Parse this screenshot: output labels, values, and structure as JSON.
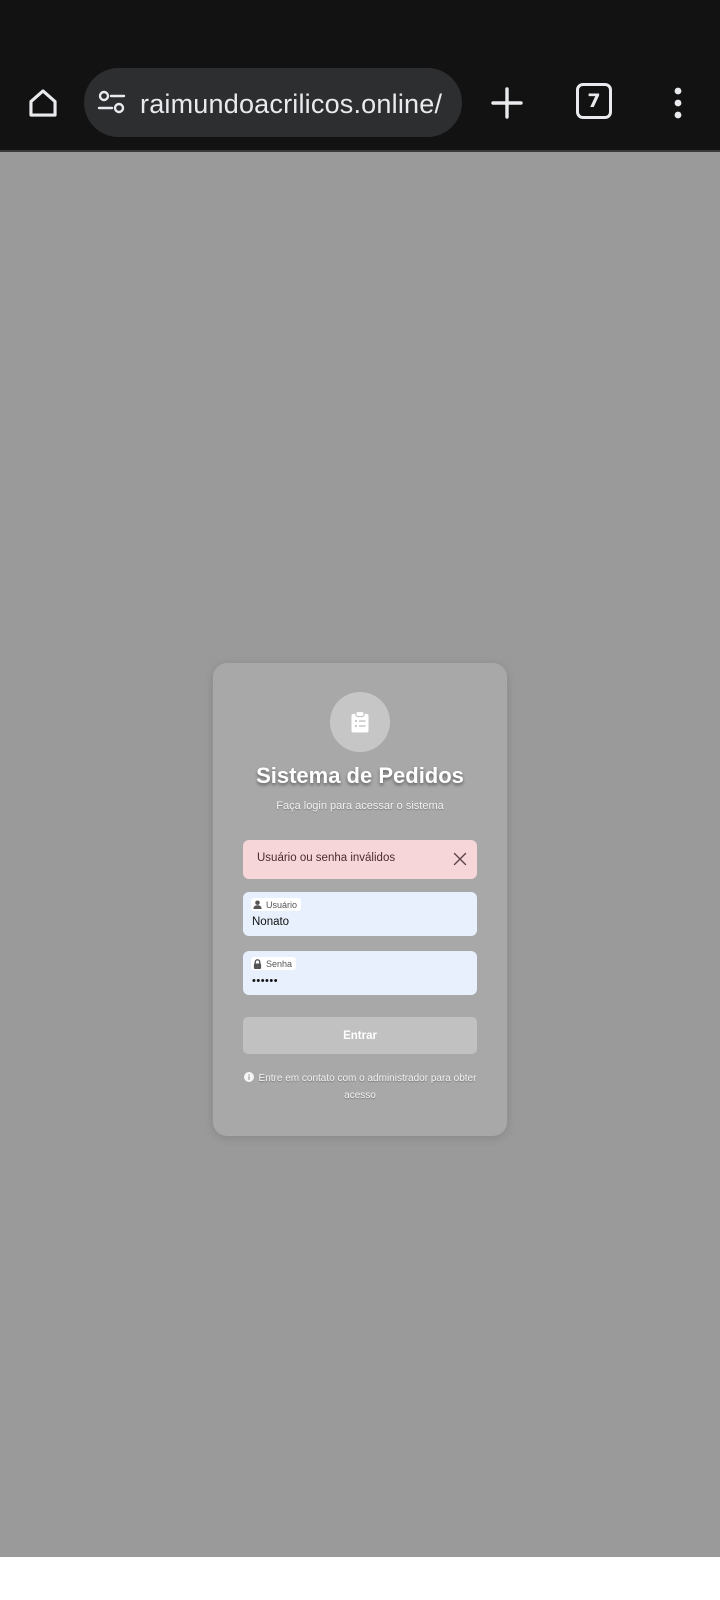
{
  "browser": {
    "url": "raimundoacrilicos.online/",
    "tabs_count": "7"
  },
  "icons": {
    "home": "home-icon",
    "site_settings": "tune-icon",
    "new_tab": "plus-icon",
    "tabs": "tab-switcher-icon",
    "menu": "more-vert-icon",
    "logo": "clipboard-list-icon",
    "close": "close-icon",
    "user": "user-icon",
    "lock": "lock-icon",
    "info": "info-circle-icon"
  },
  "login": {
    "title": "Sistema de Pedidos",
    "subtitle": "Faça login para acessar o sistema",
    "error": "Usuário ou senha inválidos",
    "username_label": "Usuário",
    "username_value": "Nonato",
    "password_label": "Senha",
    "password_value": "••••••",
    "submit_label": "Entrar",
    "info_text": "Entre em contato com o administrador para obter acesso"
  },
  "colors": {
    "browser_bar": "#121212",
    "page_background": "#9a9a9a",
    "card": "#a8a8a8",
    "alert_background": "#f7d6d9",
    "input_background": "#e8f0fe",
    "button": "#c1c1c1"
  }
}
